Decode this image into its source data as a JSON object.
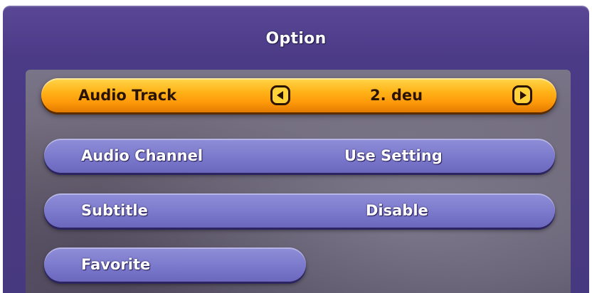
{
  "title": "Option",
  "rows": [
    {
      "label": "Audio Track",
      "value": "2. deu"
    },
    {
      "label": "Audio Channel",
      "value": "Use Setting"
    },
    {
      "label": "Subtitle",
      "value": "Disable"
    },
    {
      "label": "Favorite",
      "value": ""
    }
  ],
  "icons": {
    "left": "arrow-left-icon",
    "right": "arrow-right-icon"
  },
  "colors": {
    "panel": "#4b3a86",
    "row": "#7b79cc",
    "selected": "#ffb318"
  }
}
